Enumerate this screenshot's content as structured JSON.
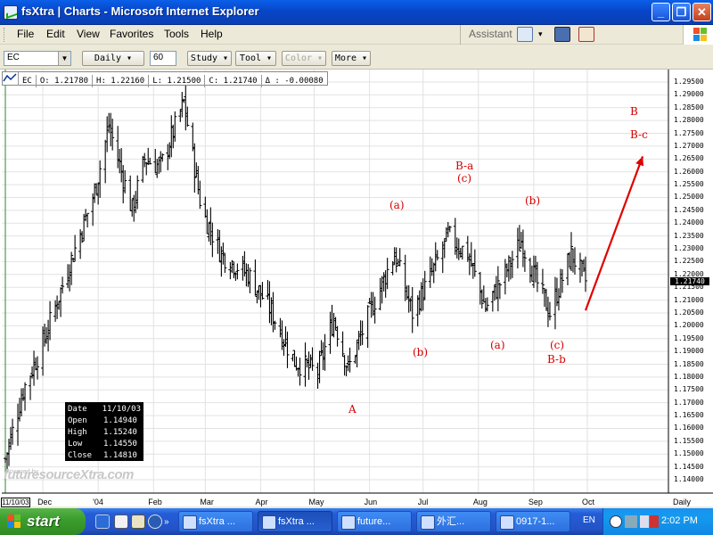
{
  "window": {
    "title": "fsXtra | Charts - Microsoft Internet Explorer",
    "controls": [
      "_",
      "❐",
      "✕"
    ]
  },
  "menu": {
    "items": [
      "File",
      "Edit",
      "View",
      "Favorites",
      "Tools",
      "Help"
    ],
    "assistant": "Assistant"
  },
  "toolbar": {
    "symbol": "EC",
    "interval": "Daily",
    "period": "60",
    "study": "Study",
    "tool": "Tool",
    "color": "Color",
    "more": "More"
  },
  "quote": {
    "symbol": "EC",
    "open": "O: 1.21780",
    "high": "H: 1.22160",
    "low": "L: 1.21500",
    "close": "C: 1.21740",
    "change": "Δ : -0.00080"
  },
  "info_box": {
    "rows": [
      {
        "k": "Date",
        "v": "11/10/03"
      },
      {
        "k": "Open",
        "v": "1.14940"
      },
      {
        "k": "High",
        "v": "1.15240"
      },
      {
        "k": "Low",
        "v": "1.14550"
      },
      {
        "k": "Close",
        "v": "1.14810"
      }
    ]
  },
  "watermark": {
    "top": "Powered by",
    "main": "futuresourceXtra.com"
  },
  "price_tag": "1.21740",
  "annotations": {
    "a_main": "A",
    "b_small_1": "(b)",
    "a_small_1": "(a)",
    "b_a": "B-a",
    "c_small_1": "(c)",
    "a_small_2": "(a)",
    "b_small_2": "(b)",
    "c_small_2": "(c)",
    "b_b": "B-b",
    "b_main": "B",
    "b_c": "B-c"
  },
  "chart_data": {
    "type": "ohlc",
    "symbol": "EC",
    "interval": "Daily",
    "y_axis": [
      "1.29500",
      "1.29000",
      "1.28500",
      "1.28000",
      "1.27500",
      "1.27000",
      "1.26500",
      "1.26000",
      "1.25500",
      "1.25000",
      "1.24500",
      "1.24000",
      "1.23500",
      "1.23000",
      "1.22500",
      "1.22000",
      "1.21500",
      "1.21000",
      "1.20500",
      "1.20000",
      "1.19500",
      "1.19000",
      "1.18500",
      "1.18000",
      "1.17500",
      "1.17000",
      "1.16500",
      "1.16000",
      "1.15500",
      "1.15000",
      "1.14500",
      "1.14000"
    ],
    "x_axis": [
      "11/10/03",
      "Dec",
      "'04",
      "Feb",
      "Mar",
      "Apr",
      "May",
      "Jun",
      "Jul",
      "Aug",
      "Sep",
      "Oct"
    ],
    "x_axis_end_label": "Daily",
    "ylim": [
      1.137,
      1.298
    ],
    "last_close": 1.2174,
    "close_path": [
      {
        "date": "2003-11-10",
        "close": 1.1481
      },
      {
        "date": "2003-11-20",
        "close": 1.175
      },
      {
        "date": "2003-12-01",
        "close": 1.193
      },
      {
        "date": "2003-12-15",
        "close": 1.222
      },
      {
        "date": "2003-12-30",
        "close": 1.252
      },
      {
        "date": "2004-01-07",
        "close": 1.278
      },
      {
        "date": "2004-01-20",
        "close": 1.245
      },
      {
        "date": "2004-01-27",
        "close": 1.265
      },
      {
        "date": "2004-02-05",
        "close": 1.262
      },
      {
        "date": "2004-02-18",
        "close": 1.287
      },
      {
        "date": "2004-02-28",
        "close": 1.245
      },
      {
        "date": "2004-03-10",
        "close": 1.228
      },
      {
        "date": "2004-03-25",
        "close": 1.22
      },
      {
        "date": "2004-04-06",
        "close": 1.207
      },
      {
        "date": "2004-04-20",
        "close": 1.186
      },
      {
        "date": "2004-05-03",
        "close": 1.182
      },
      {
        "date": "2004-05-12",
        "close": 1.203
      },
      {
        "date": "2004-05-20",
        "close": 1.183
      },
      {
        "date": "2004-06-01",
        "close": 1.205
      },
      {
        "date": "2004-06-15",
        "close": 1.228
      },
      {
        "date": "2004-06-25",
        "close": 1.205
      },
      {
        "date": "2004-07-05",
        "close": 1.219
      },
      {
        "date": "2004-07-15",
        "close": 1.235
      },
      {
        "date": "2004-07-26",
        "close": 1.228
      },
      {
        "date": "2004-08-05",
        "close": 1.207
      },
      {
        "date": "2004-08-15",
        "close": 1.219
      },
      {
        "date": "2004-08-25",
        "close": 1.233
      },
      {
        "date": "2004-09-02",
        "close": 1.218
      },
      {
        "date": "2004-09-10",
        "close": 1.205
      },
      {
        "date": "2004-09-22",
        "close": 1.228
      },
      {
        "date": "2004-09-30",
        "close": 1.2174
      }
    ],
    "projection": {
      "from": {
        "date": "2004-09-30",
        "value": 1.206
      },
      "to": {
        "date": "2004-11-01",
        "value": 1.266
      }
    }
  }
}
